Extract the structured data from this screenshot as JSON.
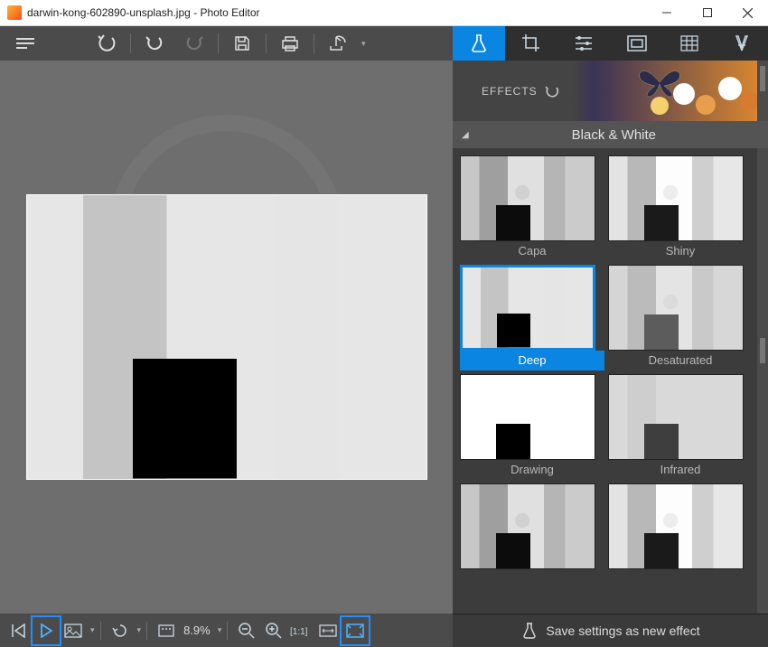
{
  "window": {
    "title": "darwin-kong-602890-unsplash.jpg - Photo Editor"
  },
  "toolbar": {
    "tabs": [
      "effects",
      "crop",
      "adjust",
      "frame",
      "texture",
      "text"
    ],
    "active_tab_index": 0
  },
  "effects_panel": {
    "label": "EFFECTS",
    "category": "Black & White",
    "items": [
      {
        "label": "Capa",
        "selected": false,
        "variant": "dim"
      },
      {
        "label": "Shiny",
        "selected": false,
        "variant": ""
      },
      {
        "label": "Deep",
        "selected": true,
        "variant": "deep"
      },
      {
        "label": "Desaturated",
        "selected": false,
        "variant": "faded"
      },
      {
        "label": "Drawing",
        "selected": false,
        "variant": "drawing"
      },
      {
        "label": "Infrared",
        "selected": false,
        "variant": "infra"
      },
      {
        "label": "",
        "selected": false,
        "variant": "dim"
      },
      {
        "label": "",
        "selected": false,
        "variant": ""
      }
    ]
  },
  "bottom": {
    "zoom_label": "8.9%",
    "save_effect_label": "Save settings as new effect"
  },
  "colors": {
    "accent": "#0b85e2"
  }
}
